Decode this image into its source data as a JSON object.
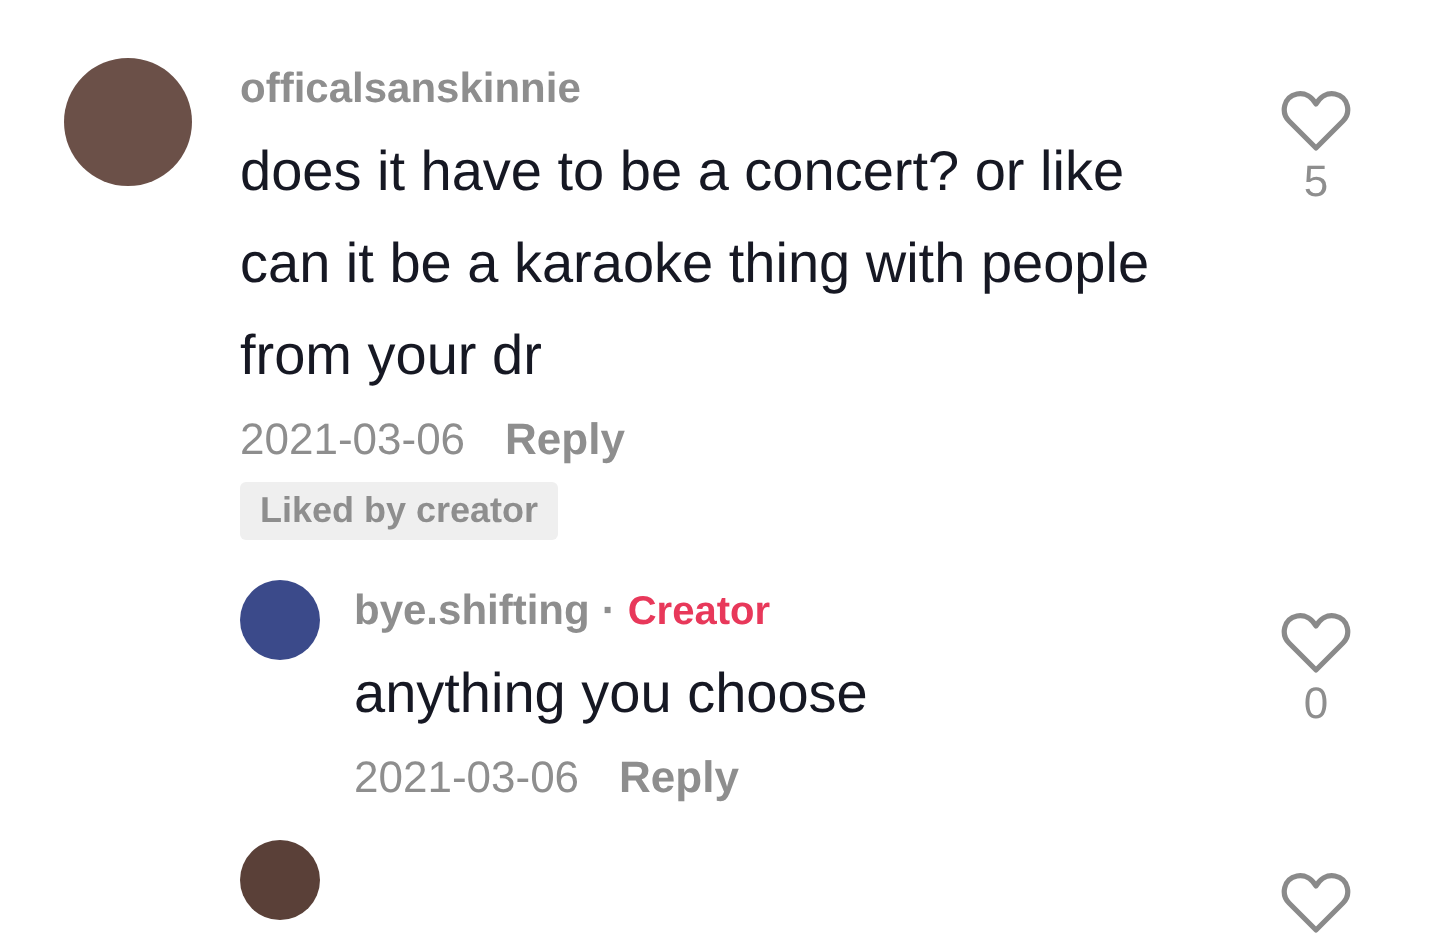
{
  "comments": [
    {
      "username": "officalsanskinnie",
      "text": "does it have to be a concert? or like can it be a karaoke thing with people from your dr",
      "date": "2021-03-06",
      "reply_label": "Reply",
      "liked_by_creator": "Liked by creator",
      "likes": "5",
      "replies": [
        {
          "username": "bye.shifting",
          "separator": "·",
          "badge": "Creator",
          "text": "anything you choose",
          "date": "2021-03-06",
          "reply_label": "Reply",
          "likes": "0"
        }
      ]
    }
  ]
}
